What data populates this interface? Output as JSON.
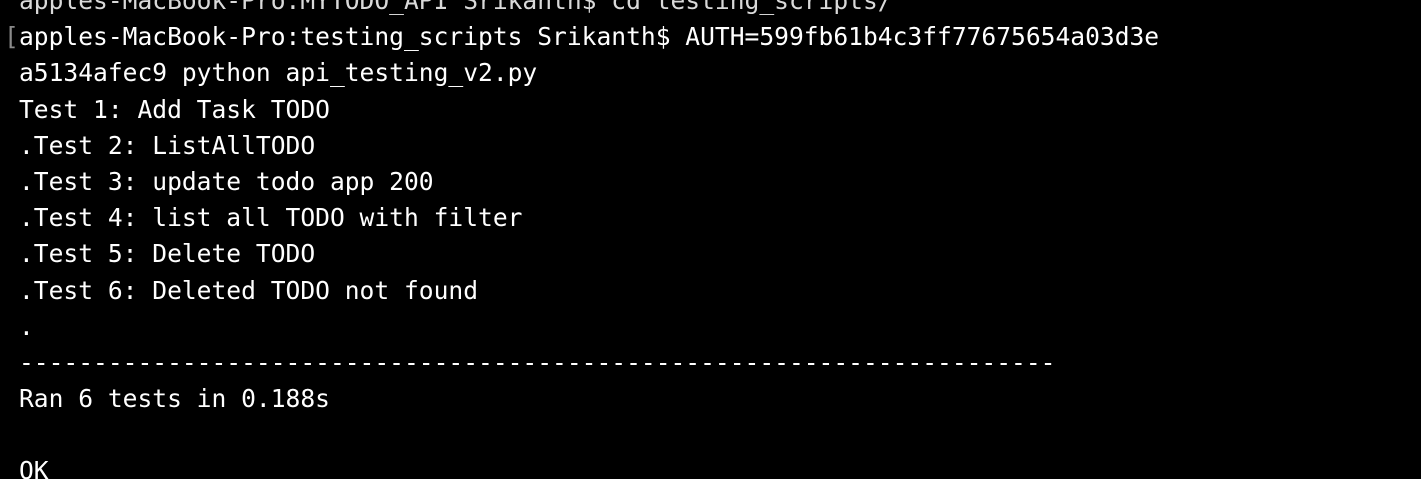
{
  "terminal": {
    "clipped_top_line": "apples-MacBook-Pro:MYTODO_API Srikanth$ cd testing_scripts/",
    "bracket_marker": "[",
    "lines": [
      "apples-MacBook-Pro:testing_scripts Srikanth$ AUTH=599fb61b4c3ff77675654a03d3e",
      "a5134afec9 python api_testing_v2.py",
      "Test 1: Add Task TODO",
      ".Test 2: ListAllTODO",
      ".Test 3: update todo app 200",
      ".Test 4: list all TODO with filter",
      ".Test 5: Delete TODO",
      ".Test 6: Deleted TODO not found",
      ".",
      "----------------------------------------------------------------------",
      "Ran 6 tests in 0.188s",
      "",
      "OK"
    ]
  },
  "colors": {
    "background": "#000000",
    "foreground": "#ffffff"
  }
}
